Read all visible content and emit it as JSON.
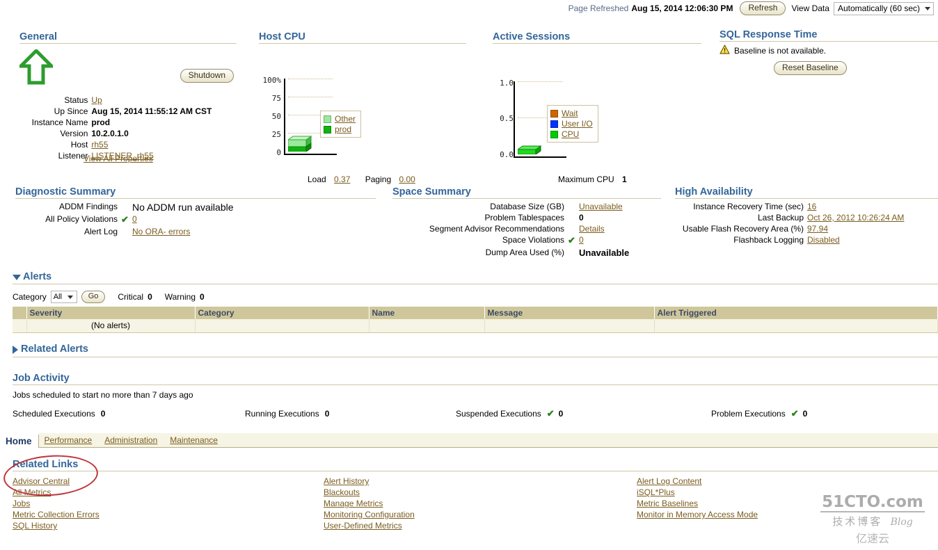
{
  "topbar": {
    "refreshed_label": "Page Refreshed",
    "refreshed_date": "Aug 15, 2014 12:06:30 PM",
    "refresh_button": "Refresh",
    "view_data_label": "View Data",
    "view_data_value": "Automatically (60 sec)"
  },
  "general": {
    "title": "General",
    "shutdown_button": "Shutdown",
    "status_label": "Status",
    "status_value": "Up",
    "up_since_label": "Up Since",
    "up_since_value": "Aug 15, 2014 11:55:12 AM CST",
    "instance_label": "Instance Name",
    "instance_value": "prod",
    "version_label": "Version",
    "version_value": "10.2.0.1.0",
    "host_label": "Host",
    "host_value": "rh55",
    "listener_label": "Listener",
    "listener_value": "LISTENER_rh55",
    "view_all": "View All Properties"
  },
  "host_cpu": {
    "title": "Host CPU",
    "load_label": "Load",
    "load_value": "0.37",
    "paging_label": "Paging",
    "paging_value": "0.00"
  },
  "active_sessions": {
    "title": "Active Sessions",
    "max_cpu_label": "Maximum CPU",
    "max_cpu_value": "1"
  },
  "sql_response": {
    "title": "SQL Response Time",
    "message": "Baseline is not available.",
    "reset_button": "Reset Baseline"
  },
  "diagnostic": {
    "title": "Diagnostic Summary",
    "rows": [
      {
        "label": "ADDM Findings",
        "value": "No ADDM run available",
        "check": false,
        "link": false,
        "bold": false
      },
      {
        "label": "All Policy Violations",
        "value": "0",
        "check": true,
        "link": true,
        "bold": false
      },
      {
        "label": "Alert Log",
        "value": "No ORA- errors",
        "check": false,
        "link": true,
        "bold": false
      }
    ]
  },
  "space": {
    "title": "Space Summary",
    "rows": [
      {
        "label": "Database Size (GB)",
        "value": "Unavailable",
        "check": false,
        "link": true,
        "bold": false
      },
      {
        "label": "Problem Tablespaces",
        "value": "0",
        "check": false,
        "link": false,
        "bold": true
      },
      {
        "label": "Segment Advisor Recommendations",
        "value": "Details",
        "check": false,
        "link": true,
        "bold": false
      },
      {
        "label": "Space Violations",
        "value": "0",
        "check": true,
        "link": true,
        "bold": false
      },
      {
        "label": "Dump Area Used (%)",
        "value": "Unavailable",
        "check": false,
        "link": false,
        "bold": true
      }
    ]
  },
  "high_availability": {
    "title": "High Availability",
    "rows": [
      {
        "label": "Instance Recovery Time (sec)",
        "value": "16",
        "check": false,
        "link": true,
        "bold": false
      },
      {
        "label": "Last Backup",
        "value": "Oct 26, 2012 10:26:24 AM",
        "check": false,
        "link": true,
        "bold": false
      },
      {
        "label": "Usable Flash Recovery Area (%)",
        "value": "97.94",
        "check": false,
        "link": true,
        "bold": false
      },
      {
        "label": "Flashback Logging",
        "value": "Disabled",
        "check": false,
        "link": true,
        "bold": false
      }
    ]
  },
  "alerts": {
    "title": "Alerts",
    "category_label": "Category",
    "category_value": "All",
    "go_button": "Go",
    "critical_label": "Critical",
    "critical_value": "0",
    "warning_label": "Warning",
    "warning_value": "0",
    "columns": [
      "",
      "Severity",
      "Category",
      "Name",
      "Message",
      "Alert Triggered"
    ],
    "empty_text": "(No alerts)"
  },
  "related_alerts": {
    "title": "Related Alerts"
  },
  "job_activity": {
    "title": "Job Activity",
    "note": "Jobs scheduled to start no more than 7 days ago",
    "cells": [
      {
        "label": "Scheduled Executions",
        "value": "0",
        "check": false
      },
      {
        "label": "Running Executions",
        "value": "0",
        "check": false
      },
      {
        "label": "Suspended Executions",
        "value": "0",
        "check": true
      },
      {
        "label": "Problem Executions",
        "value": "0",
        "check": true
      }
    ]
  },
  "tabs": {
    "active": "Home",
    "items": [
      "Performance",
      "Administration",
      "Maintenance"
    ]
  },
  "related_links": {
    "title": "Related Links",
    "col1": [
      "Advisor Central",
      "All Metrics",
      "Jobs",
      "Metric Collection Errors",
      "SQL History"
    ],
    "col2": [
      "Alert History",
      "Blackouts",
      "Manage Metrics",
      "Monitoring Configuration",
      "User-Defined Metrics"
    ],
    "col3": [
      "Alert Log Content",
      "iSQL*Plus",
      "Metric Baselines",
      "Monitor in Memory Access Mode"
    ]
  },
  "watermark": {
    "line1": "51CTO.com",
    "line2": "技术博客",
    "line3": "Blog",
    "line4": "亿速云"
  },
  "colors": {
    "heading": "#336699",
    "link": "#7a5c1e",
    "rule": "#cfc8a8",
    "table_header_bg": "#cfc79b",
    "table_row_bg": "#f6f4e4",
    "annotation": "#c0343c",
    "cpu_other": "#9ce89c",
    "cpu_prod": "#0fb40f",
    "wait": "#cc6600",
    "user_io": "#0033ff",
    "cpu": "#00cc00"
  },
  "chart_data": [
    {
      "type": "bar",
      "title": "Host CPU",
      "ylabel": "",
      "ylim": [
        0,
        100
      ],
      "yticks": [
        "100%",
        "75",
        "50",
        "25",
        "0"
      ],
      "ytick_values": [
        100,
        75,
        50,
        25,
        0
      ],
      "categories": [
        "Host CPU"
      ],
      "series": [
        {
          "name": "prod",
          "values": [
            3
          ],
          "color": "#0fb40f"
        },
        {
          "name": "Other",
          "values": [
            9
          ],
          "color": "#9ce89c"
        }
      ],
      "legend_position": "center",
      "grid": true,
      "annotations": [
        "Load 0.37",
        "Paging 0.00"
      ]
    },
    {
      "type": "bar",
      "title": "Active Sessions",
      "ylabel": "",
      "ylim": [
        0,
        1.0
      ],
      "yticks": [
        "1.0",
        "0.5",
        "0.0"
      ],
      "ytick_values": [
        1.0,
        0.5,
        0.0
      ],
      "categories": [
        "Active Sessions"
      ],
      "series": [
        {
          "name": "Wait",
          "values": [
            0
          ],
          "color": "#cc6600"
        },
        {
          "name": "User I/O",
          "values": [
            0
          ],
          "color": "#0033ff"
        },
        {
          "name": "CPU",
          "values": [
            0.04
          ],
          "color": "#00cc00"
        }
      ],
      "legend_position": "center",
      "grid": true,
      "annotations": [
        "Maximum CPU 1"
      ]
    }
  ]
}
